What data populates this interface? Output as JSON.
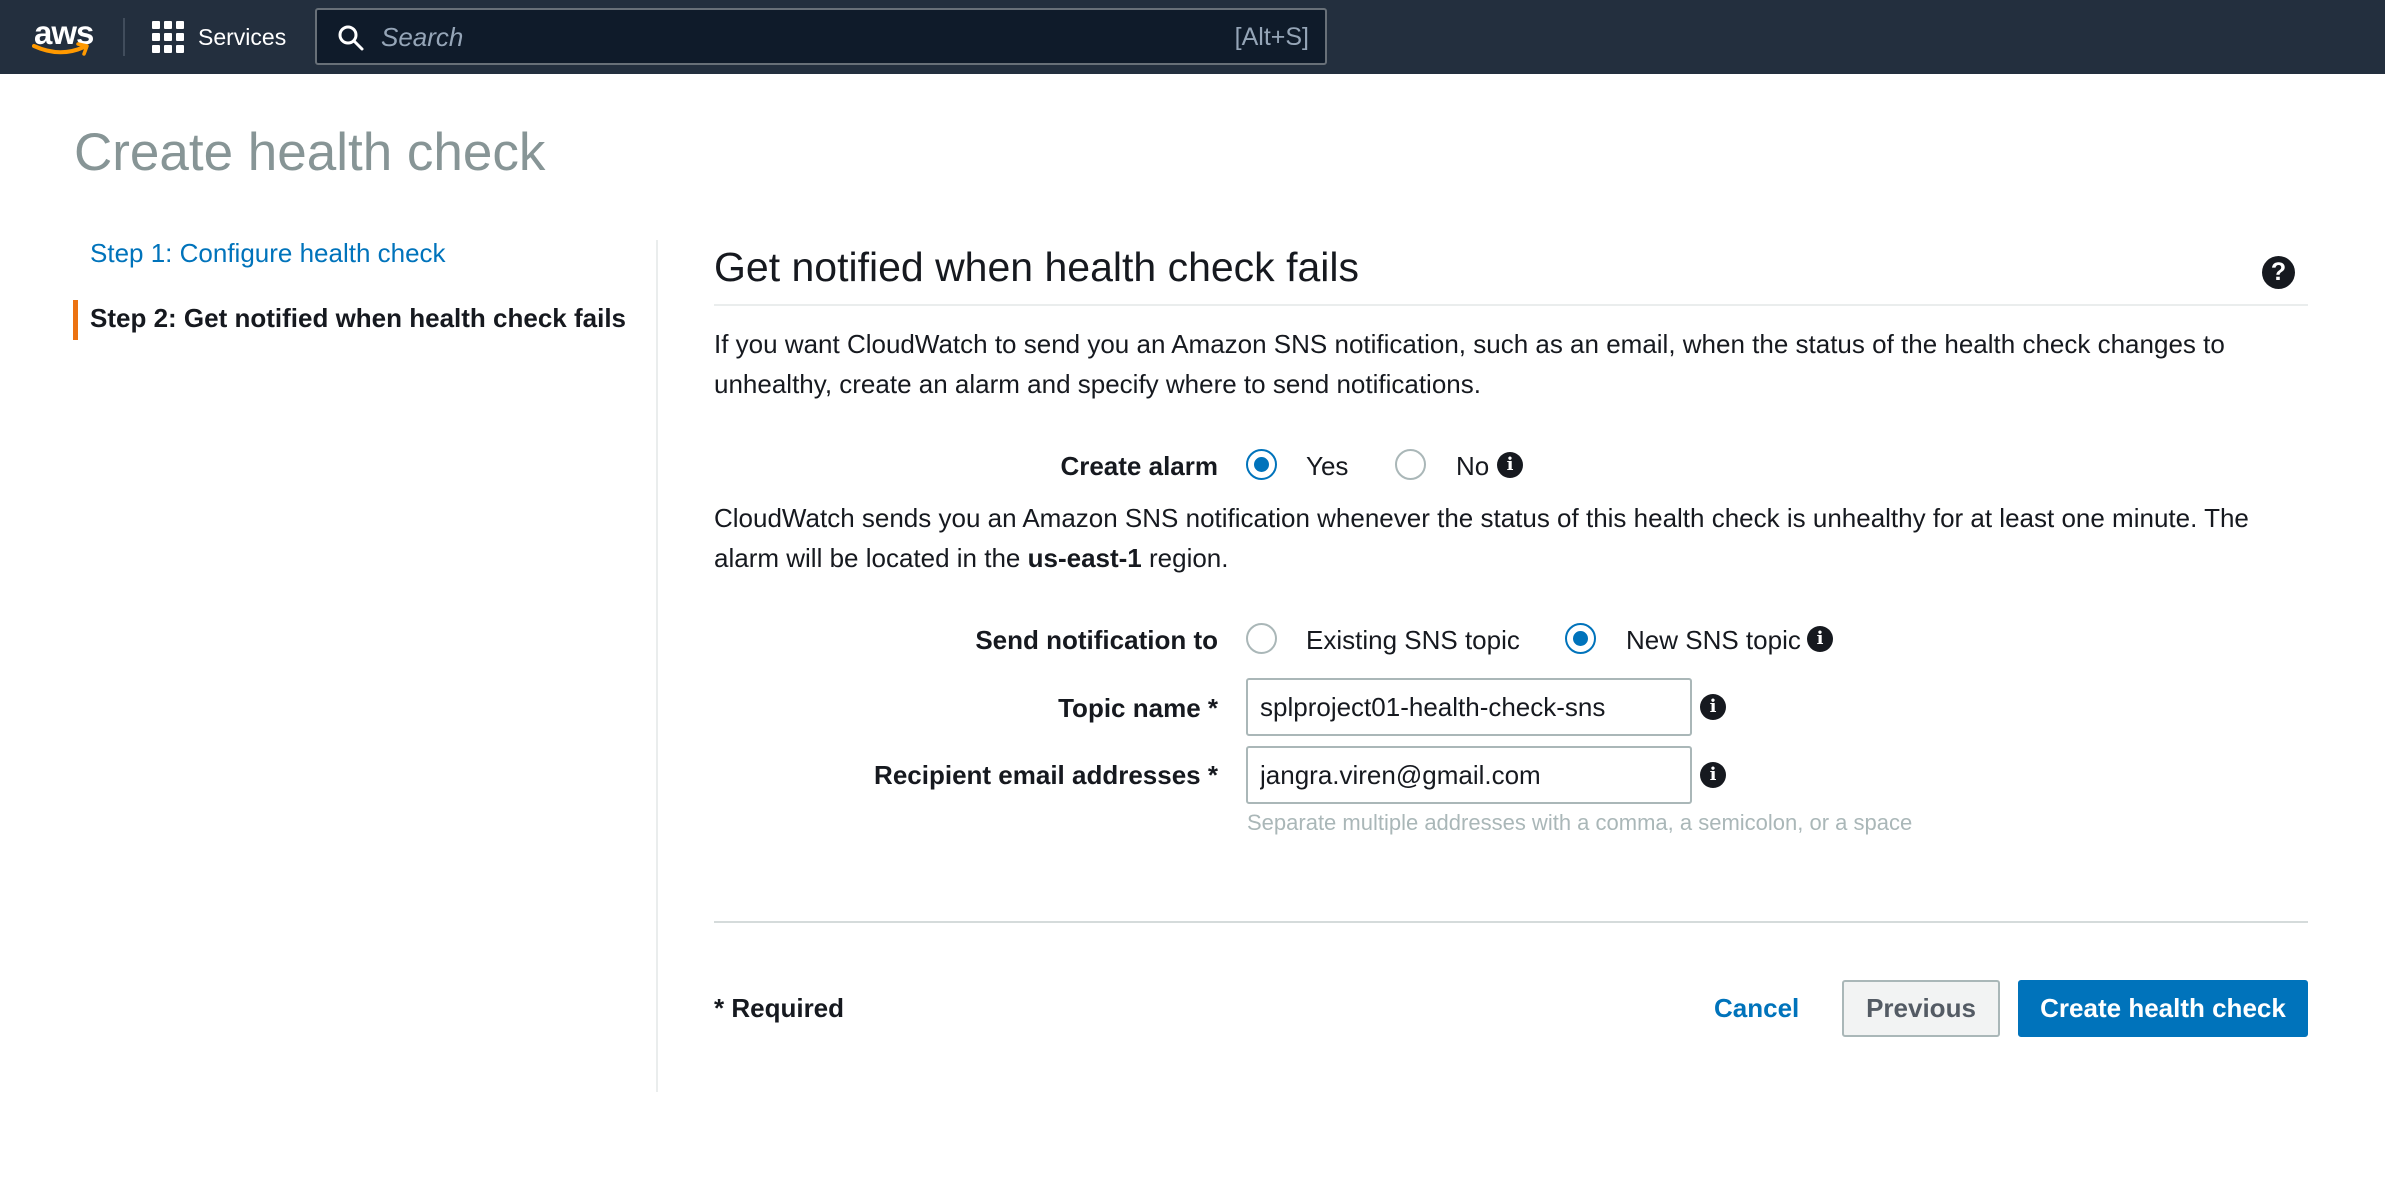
{
  "topnav": {
    "logo_text": "aws",
    "services_label": "Services",
    "search_placeholder": "Search",
    "search_shortcut": "[Alt+S]"
  },
  "page": {
    "title": "Create health check"
  },
  "steps": [
    {
      "label": "Step 1: Configure health check",
      "active": false
    },
    {
      "label": "Step 2: Get notified when health check fails",
      "active": true
    }
  ],
  "section": {
    "title": "Get notified when health check fails",
    "intro": "If you want CloudWatch to send you an Amazon SNS notification, such as an email, when the status of the health check changes to unhealthy, create an alarm and specify where to send notifications.",
    "alarm_info_prefix": "CloudWatch sends you an Amazon SNS notification whenever the status of this health check is unhealthy for at least one minute. The alarm will be located in the ",
    "alarm_region": "us-east-1",
    "alarm_info_suffix": " region."
  },
  "form": {
    "create_alarm": {
      "label": "Create alarm",
      "options": [
        "Yes",
        "No"
      ],
      "selected": "Yes"
    },
    "send_notification": {
      "label": "Send notification to",
      "options": [
        "Existing SNS topic",
        "New SNS topic"
      ],
      "selected": "New SNS topic"
    },
    "topic_name": {
      "label": "Topic name *",
      "value": "splproject01-health-check-sns"
    },
    "recipient_emails": {
      "label": "Recipient email addresses *",
      "value": "jangra.viren@gmail.com",
      "hint": "Separate multiple addresses with a comma, a semicolon, or a space"
    }
  },
  "footer": {
    "required_note": "* Required",
    "cancel_label": "Cancel",
    "previous_label": "Previous",
    "submit_label": "Create health check"
  },
  "colors": {
    "nav_bg": "#232f3e",
    "link": "#0073bb",
    "active_step_accent": "#ec7211",
    "primary_button": "#0073bb",
    "title_gray": "#879596"
  }
}
